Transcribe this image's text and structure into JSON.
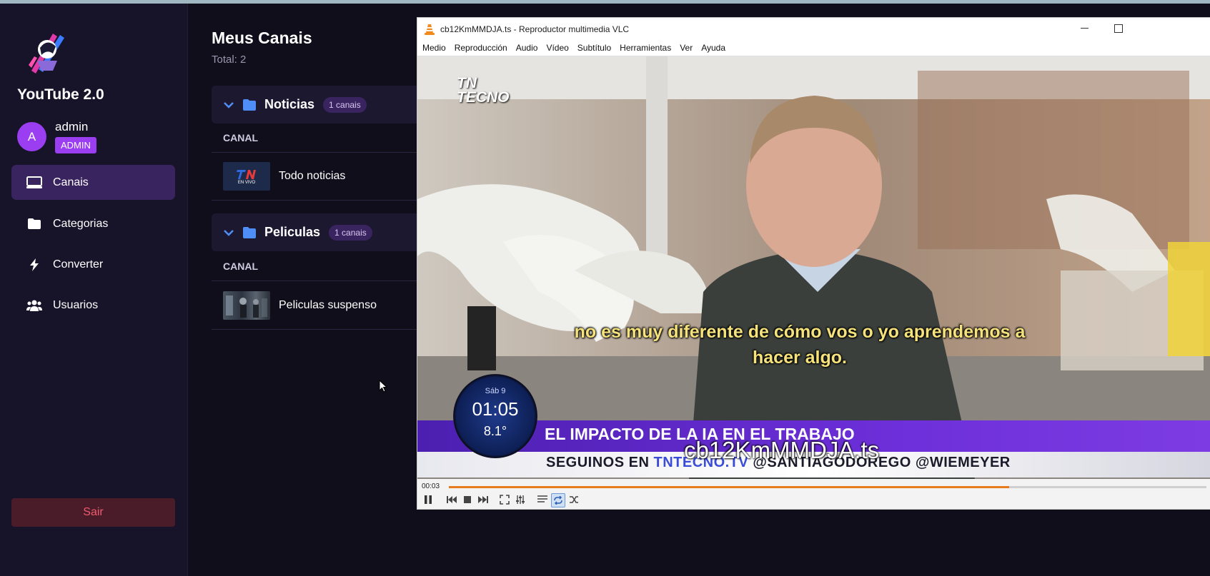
{
  "app": {
    "title": "YouTube 2.0",
    "user": {
      "name": "admin",
      "initial": "A",
      "role": "ADMIN"
    },
    "logout_label": "Sair"
  },
  "sidebar": {
    "items": [
      {
        "label": "Canais",
        "icon": "monitor-icon",
        "active": true
      },
      {
        "label": "Categorias",
        "icon": "folder-icon",
        "active": false
      },
      {
        "label": "Converter",
        "icon": "bolt-icon",
        "active": false
      },
      {
        "label": "Usuarios",
        "icon": "users-icon",
        "active": false
      }
    ]
  },
  "main": {
    "title": "Meus Canais",
    "total": "Total: 2",
    "column_header": "CANAL",
    "groups": [
      {
        "name": "Noticias",
        "count": "1 canais",
        "channels": [
          {
            "name": "Todo noticias",
            "thumb_text": "EN VIVO"
          }
        ]
      },
      {
        "name": "Peliculas",
        "count": "1 canais",
        "channels": [
          {
            "name": "Peliculas suspenso"
          }
        ]
      }
    ]
  },
  "vlc": {
    "window_title": "cb12KmMMDJA.ts - Reproductor multimedia VLC",
    "menu": [
      "Medio",
      "Reproducción",
      "Audio",
      "Vídeo",
      "Subtítulo",
      "Herramientas",
      "Ver",
      "Ayuda"
    ],
    "video": {
      "logo_line1": "TN",
      "logo_line2": "TECNO",
      "subtitle_line1": "no es muy diferente de cómo vos o yo aprendemos a",
      "subtitle_line2": "hacer algo.",
      "clock_day": "Sáb 9",
      "clock_time": "01:05",
      "clock_temp": "8.1°",
      "banner": "EL IMPACTO DE LA IA EN EL TRABAJO",
      "ticker_prefix": "SEGUINOS  EN ",
      "ticker_highlight": "TNTECNO.TV",
      "ticker_suffix": " @SANTIAGODOREGO  @WIEMEYER",
      "osd_filename": "cb12KmMMDJA.ts"
    },
    "time_current": "00:03",
    "progress": 0.74,
    "colors": {
      "accent": "#9b3df0",
      "vlc_orange": "#e87a1e",
      "banner_purple": "#5a23c2"
    }
  }
}
